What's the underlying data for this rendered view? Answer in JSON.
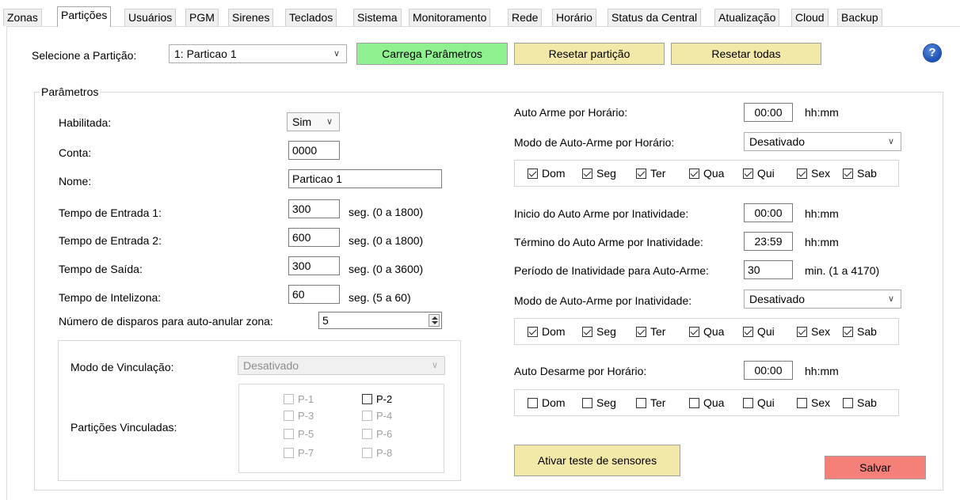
{
  "tabs": [
    "Zonas",
    "Partições",
    "Usuários",
    "PGM",
    "Sirenes",
    "Teclados",
    "Sistema",
    "Monitoramento",
    "Rede",
    "Horário",
    "Status da Central",
    "Atualização",
    "Cloud",
    "Backup"
  ],
  "top": {
    "select_partition_label": "Selecione a Partição:",
    "partition_selected": "1: Particao 1",
    "load_button": "Carrega Parâmetros",
    "reset_partition_button": "Resetar partição",
    "reset_all_button": "Resetar todas",
    "help_glyph": "?"
  },
  "colors": {
    "load_button": "#8ef08e",
    "reset_buttons": "#f2e8a8",
    "test_button": "#f2e8a8",
    "save_button": "#f5807a"
  },
  "params": {
    "group_title": "Parâmetros",
    "enabled_label": "Habilitada:",
    "enabled_value": "Sim",
    "account_label": "Conta:",
    "account_value": "0000",
    "name_label": "Nome:",
    "name_value": "Particao 1",
    "entry1_label": "Tempo de Entrada 1:",
    "entry1_value": "300",
    "entry1_range": "seg. (0 a 1800)",
    "entry2_label": "Tempo de Entrada 2:",
    "entry2_value": "600",
    "entry2_range": "seg. (0 a 1800)",
    "exit_label": "Tempo de Saída:",
    "exit_value": "300",
    "exit_range": "seg. (0 a 3600)",
    "intelizone_label": "Tempo de Intelizona:",
    "intelizone_value": "60",
    "intelizone_range": "seg. (5 a 60)",
    "shots_label": "Número de disparos para auto-anular zona:",
    "shots_value": "5"
  },
  "link": {
    "mode_label": "Modo de Vinculação:",
    "mode_value": "Desativado",
    "linked_label": "Partições  Vinculadas:",
    "partitions": [
      {
        "label": "P-1",
        "checked": false,
        "enabled": false
      },
      {
        "label": "P-2",
        "checked": false,
        "enabled": true
      },
      {
        "label": "P-3",
        "checked": false,
        "enabled": false
      },
      {
        "label": "P-4",
        "checked": false,
        "enabled": false
      },
      {
        "label": "P-5",
        "checked": false,
        "enabled": false
      },
      {
        "label": "P-6",
        "checked": false,
        "enabled": false
      },
      {
        "label": "P-7",
        "checked": false,
        "enabled": false
      },
      {
        "label": "P-8",
        "checked": false,
        "enabled": false
      }
    ]
  },
  "auto": {
    "auto_arm_time_label": "Auto Arme por Horário:",
    "auto_arm_time_value": "00:00",
    "hhmm": "hh:mm",
    "auto_arm_mode_label": "Modo de Auto-Arme por Horário:",
    "auto_arm_mode_value": "Desativado",
    "days_arm_time": [
      {
        "label": "Dom",
        "checked": true
      },
      {
        "label": "Seg",
        "checked": true
      },
      {
        "label": "Ter",
        "checked": true
      },
      {
        "label": "Qua",
        "checked": true
      },
      {
        "label": "Qui",
        "checked": true
      },
      {
        "label": "Sex",
        "checked": true
      },
      {
        "label": "Sab",
        "checked": true
      }
    ],
    "inactivity_start_label": "Inicio do Auto Arme por Inatividade:",
    "inactivity_start_value": "00:00",
    "inactivity_end_label": "Término do Auto Arme por Inatividade:",
    "inactivity_end_value": "23:59",
    "inactivity_period_label": "Período de Inatividade para Auto-Arme:",
    "inactivity_period_value": "30",
    "inactivity_period_range": "min. (1 a 4170)",
    "inactivity_mode_label": "Modo de Auto-Arme por Inatividade:",
    "inactivity_mode_value": "Desativado",
    "days_inactivity": [
      {
        "label": "Dom",
        "checked": true
      },
      {
        "label": "Seg",
        "checked": true
      },
      {
        "label": "Ter",
        "checked": true
      },
      {
        "label": "Qua",
        "checked": true
      },
      {
        "label": "Qui",
        "checked": true
      },
      {
        "label": "Sex",
        "checked": true
      },
      {
        "label": "Sab",
        "checked": true
      }
    ],
    "auto_disarm_label": "Auto Desarme por Horário:",
    "auto_disarm_value": "00:00",
    "days_disarm": [
      {
        "label": "Dom",
        "checked": false
      },
      {
        "label": "Seg",
        "checked": false
      },
      {
        "label": "Ter",
        "checked": false
      },
      {
        "label": "Qua",
        "checked": false
      },
      {
        "label": "Qui",
        "checked": false
      },
      {
        "label": "Sex",
        "checked": false
      },
      {
        "label": "Sab",
        "checked": false
      }
    ]
  },
  "actions": {
    "test_sensors_button": "Ativar teste de sensores",
    "save_button": "Salvar"
  }
}
